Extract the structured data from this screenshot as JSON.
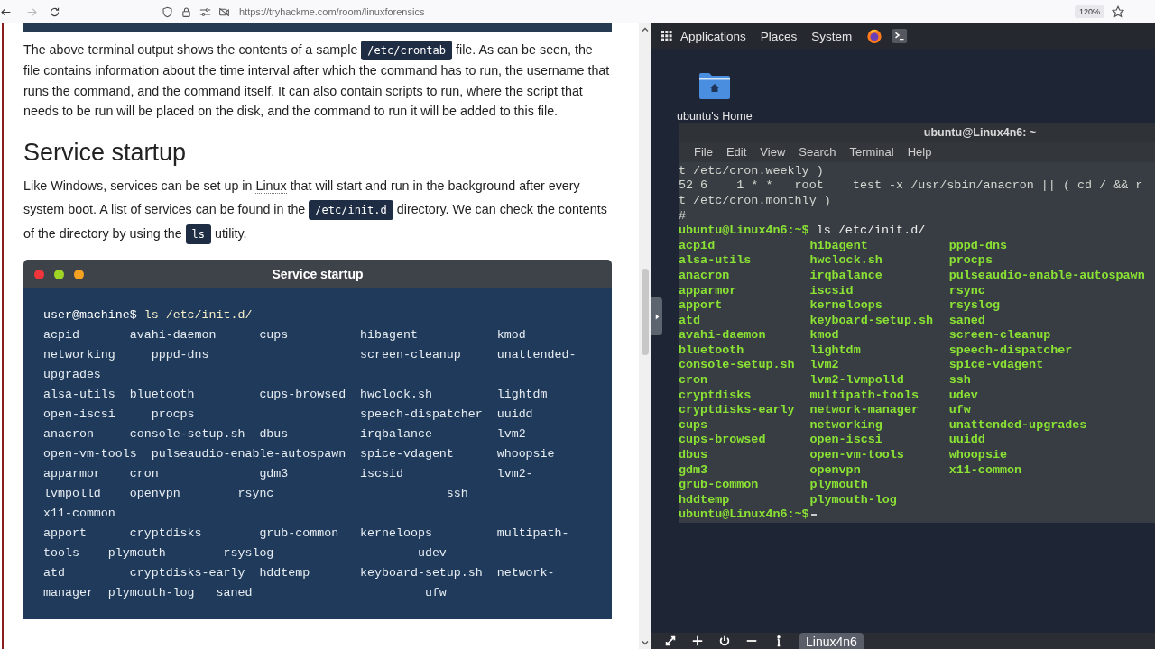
{
  "browser": {
    "nav": [
      {
        "kind": "back",
        "disabled": false
      },
      {
        "kind": "forward",
        "disabled": true
      },
      {
        "kind": "reload",
        "disabled": false
      }
    ],
    "url": "https://tryhackme.com/room/linuxforensics",
    "zoom": "120%"
  },
  "article": {
    "paragraphs": [
      [
        {
          "kind": "text",
          "text": "The above terminal output shows the contents of a sample "
        },
        {
          "kind": "code",
          "text": "/etc/crontab"
        },
        {
          "kind": "text",
          "text": " file. As can be seen, the file contains information about the time interval after which the command has to run, the username that runs the command, and the command itself. It can also contain scripts to run, where the script that needs to be run will be placed on the disk, and the command to run it will be added to this file."
        }
      ]
    ],
    "heading": "Service startup",
    "paragraphs_after": [
      [
        {
          "kind": "text",
          "text": "Like Windows, services can be set up in "
        },
        {
          "kind": "link",
          "text": "Linux"
        },
        {
          "kind": "text",
          "text": " that will start and run in the background after every system boot. A list of services can be found in the "
        },
        {
          "kind": "code",
          "text": "/etc/init.d"
        },
        {
          "kind": "text",
          "text": " directory. We can check the contents of the directory by using the "
        },
        {
          "kind": "code",
          "text": "ls"
        },
        {
          "kind": "text",
          "text": " utility."
        }
      ]
    ],
    "terminal": {
      "title": "Service startup",
      "lines": [
        {
          "kind": "prompt",
          "prompt": "user@machine$",
          "command": "ls /etc/init.d/"
        },
        {
          "kind": "output",
          "text": "acpid       avahi-daemon      cups          hibagent           kmod"
        },
        {
          "kind": "output",
          "text": "networking     pppd-dns                     screen-cleanup     unattended-"
        },
        {
          "kind": "output",
          "text": "upgrades"
        },
        {
          "kind": "output",
          "text": "alsa-utils  bluetooth         cups-browsed  hwclock.sh         lightdm"
        },
        {
          "kind": "output",
          "text": "open-iscsi     procps                       speech-dispatcher  uuidd"
        },
        {
          "kind": "output",
          "text": "anacron     console-setup.sh  dbus          irqbalance         lvm2"
        },
        {
          "kind": "output",
          "text": "open-vm-tools  pulseaudio-enable-autospawn  spice-vdagent      whoopsie"
        },
        {
          "kind": "output",
          "text": "apparmor    cron              gdm3          iscsid             lvm2-"
        },
        {
          "kind": "output",
          "text": "lvmpolld    openvpn        rsync                        ssh"
        },
        {
          "kind": "output",
          "text": "x11-common"
        },
        {
          "kind": "output",
          "text": "apport      cryptdisks        grub-common   kerneloops         multipath-"
        },
        {
          "kind": "output",
          "text": "tools    plymouth        rsyslog                    udev"
        },
        {
          "kind": "output",
          "text": "atd         cryptdisks-early  hddtemp       keyboard-setup.sh  network-"
        },
        {
          "kind": "output",
          "text": "manager  plymouth-log   saned                        ufw"
        }
      ]
    }
  },
  "desktop": {
    "panel_menu": [
      "Applications",
      "Places",
      "System"
    ],
    "home_icon_label": "ubuntu's Home",
    "terminal": {
      "title": "ubuntu@Linux4n6: ~",
      "menu": [
        "File",
        "Edit",
        "View",
        "Search",
        "Terminal",
        "Help"
      ],
      "preamble": [
        "t /etc/cron.weekly )",
        "52 6    1 * *   root    test -x /usr/sbin/anacron || ( cd / && r",
        "t /etc/cron.monthly )",
        "#"
      ],
      "prompt": "ubuntu@Linux4n6:~$",
      "command": "ls /etc/init.d/",
      "columns": [
        [
          "acpid",
          "alsa-utils",
          "anacron",
          "apparmor",
          "apport",
          "atd",
          "avahi-daemon",
          "bluetooth",
          "console-setup.sh",
          "cron",
          "cryptdisks",
          "cryptdisks-early",
          "cups",
          "cups-browsed",
          "dbus",
          "gdm3",
          "grub-common",
          "hddtemp"
        ],
        [
          "hibagent",
          "hwclock.sh",
          "irqbalance",
          "iscsid",
          "kerneloops",
          "keyboard-setup.sh",
          "kmod",
          "lightdm",
          "lvm2",
          "lvm2-lvmpolld",
          "multipath-tools",
          "network-manager",
          "networking",
          "open-iscsi",
          "open-vm-tools",
          "openvpn",
          "plymouth",
          "plymouth-log"
        ],
        [
          "pppd-dns",
          "procps",
          "pulseaudio-enable-autospawn",
          "rsync",
          "rsyslog",
          "saned",
          "screen-cleanup",
          "speech-dispatcher",
          "spice-vdagent",
          "ssh",
          "udev",
          "ufw",
          "unattended-upgrades",
          "uuidd",
          "whoopsie",
          "x11-common"
        ]
      ],
      "final_prompt": "ubuntu@Linux4n6:~$"
    },
    "machine_label": "Linux4n6"
  }
}
